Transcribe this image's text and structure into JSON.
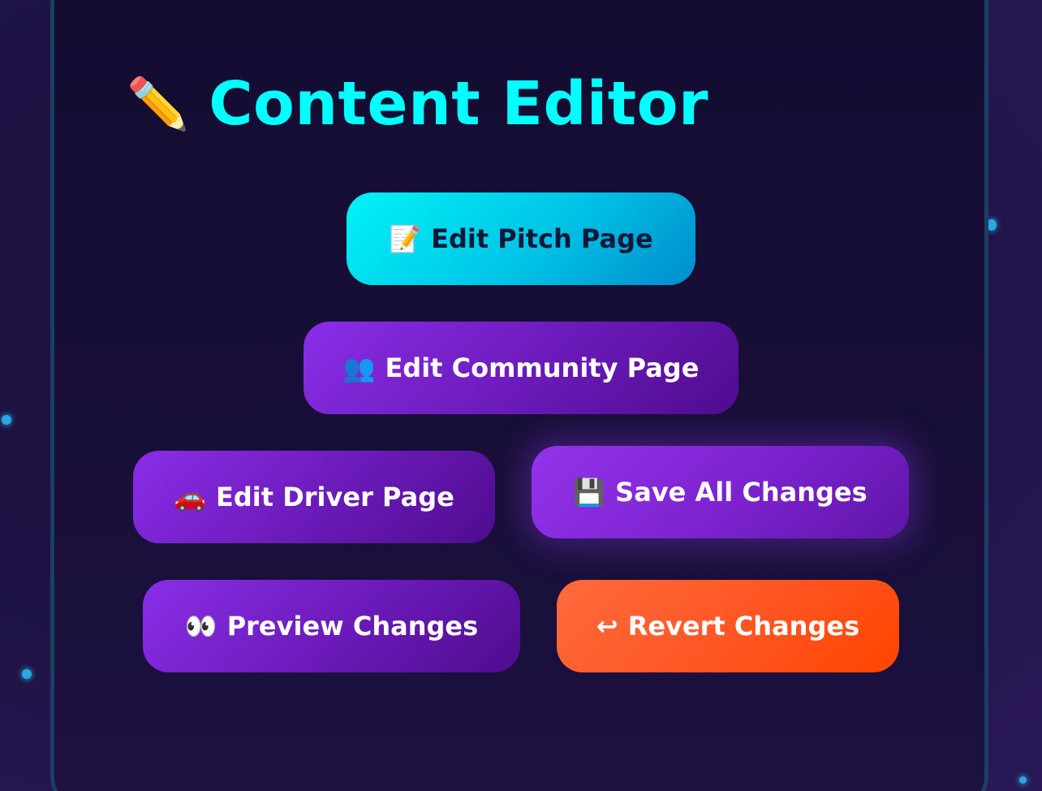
{
  "header": {
    "icon": "pencil-icon",
    "title": "Content Editor"
  },
  "buttons": {
    "edit_pitch": {
      "icon": "📝",
      "label": "Edit Pitch Page"
    },
    "edit_community": {
      "icon": "👥",
      "label": "Edit Community Page"
    },
    "edit_driver": {
      "icon": "🚗",
      "label": "Edit Driver Page"
    },
    "save_all": {
      "icon": "💾",
      "label": "Save All Changes"
    },
    "preview": {
      "icon": "👀",
      "label": "Preview Changes"
    },
    "revert": {
      "icon": "↩",
      "label": "Revert Changes"
    }
  },
  "colors": {
    "title": "#00ffff",
    "panel_border": "#1b3f63",
    "primary_button": "#00d8ee",
    "secondary_button": "#7a22d0",
    "danger_button": "#ff5522"
  }
}
